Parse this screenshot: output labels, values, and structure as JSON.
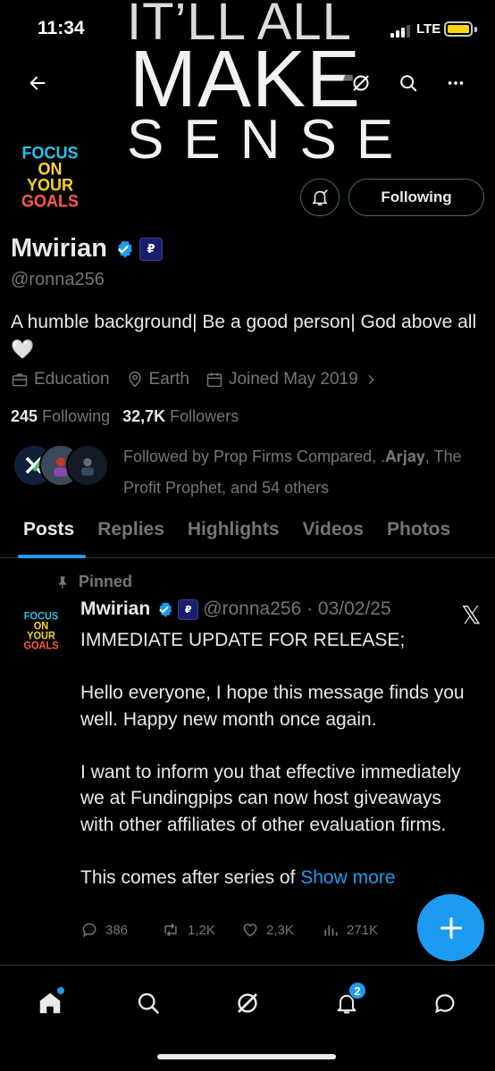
{
  "status_bar": {
    "time": "11:34",
    "network": "LTE"
  },
  "banner": {
    "line1": "IT’LL ALL",
    "line2": "MAKE",
    "line3": "SENSE"
  },
  "avatar": {
    "lines": [
      "FOCUS",
      "ON",
      "YOUR",
      "GOALS"
    ]
  },
  "profile": {
    "follow_button": "Following",
    "name": "Mwirian",
    "handle": "@ronna256",
    "bio": "A humble background| Be a good person| God above all 🤍",
    "category": "Education",
    "location": "Earth",
    "joined": "Joined May 2019",
    "following_count": "245",
    "following_label": "Following",
    "followers_count": "32,7K",
    "followers_label": "Followers",
    "followed_by": "Followed by Prop Firms Compared, .𝐀𝐫𝐣𝐚𝐲, The Profit Prophet, and 54 others"
  },
  "tabs": [
    "Posts",
    "Replies",
    "Highlights",
    "Videos",
    "Photos"
  ],
  "post": {
    "pinned_label": "Pinned",
    "author": "Mwirian",
    "meta": "@ronna256 · 03/02/25",
    "body": "IMMEDIATE UPDATE FOR RELEASE;\n\nHello everyone, I hope this message finds you well. Happy new month once again.\n\nI want to inform you that effective immediately we at Fundingpips can now host giveaways with other affiliates of other evaluation firms.\n\nThis comes after series of ",
    "show_more": "Show more",
    "replies": "386",
    "reposts": "1,2K",
    "likes": "2,3K",
    "views": "271K"
  },
  "nav": {
    "notifications_badge": "2"
  },
  "colors": {
    "accent": "#1d9bf0",
    "background": "#000000",
    "muted": "#71767b"
  }
}
